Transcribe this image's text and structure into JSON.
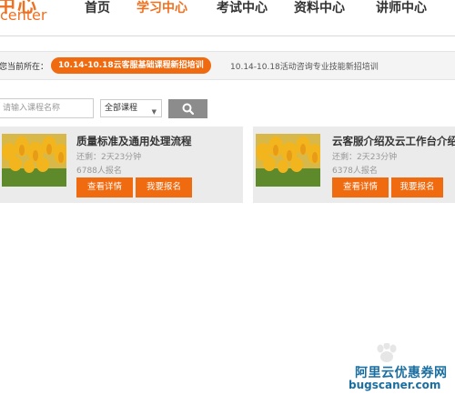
{
  "header": {
    "logo_cn": "中心",
    "logo_en": "center",
    "nav": [
      "首页",
      "学习中心",
      "考试中心",
      "资料中心",
      "讲师中心"
    ],
    "active_index": 1
  },
  "breadcrumb": {
    "label": "您当前所在：",
    "current": "10.14-10.18云客服基础课程新招培训",
    "other": "10.14-10.18活动咨询专业技能新招培训"
  },
  "search": {
    "placeholder": "请输入课程名称",
    "select_value": "全部课程",
    "button_icon": "search-icon"
  },
  "courses": [
    {
      "title": "质量标准及通用处理流程",
      "remaining": "还剩：2天23分钟",
      "enrolled": "6788人报名",
      "detail_label": "查看详情",
      "enroll_label": "我要报名"
    },
    {
      "title": "云客服介绍及云工作台介绍",
      "remaining": "还剩：2天23分钟",
      "enrolled": "6378人报名",
      "detail_label": "查看详情",
      "enroll_label": "我要报名"
    }
  ],
  "watermark": {
    "line1": "阿里云优惠券网",
    "line2": "bugscaner.com"
  },
  "colors": {
    "accent": "#f06a0f",
    "nav_active": "#f07020",
    "card_bg": "#ebebeb",
    "search_button": "#8c8c8c",
    "watermark": "#1a6ea0"
  }
}
